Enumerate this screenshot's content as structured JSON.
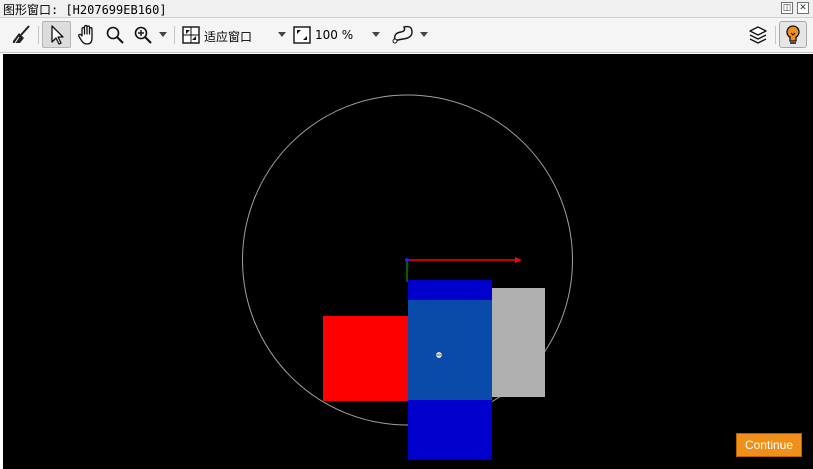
{
  "window": {
    "title": "图形窗口: [H207699EB160]",
    "restore_glyph": "◫",
    "close_glyph": "✕"
  },
  "toolbar": {
    "tools": [
      {
        "name": "clear-broom-icon",
        "active": false
      },
      {
        "name": "select-arrow-icon",
        "active": true
      },
      {
        "name": "pan-hand-icon",
        "active": false
      },
      {
        "name": "zoom-magnifier-icon",
        "active": false
      },
      {
        "name": "zoom-in-icon",
        "active": false
      }
    ],
    "fit_mode": "适应窗口",
    "zoom_level": "100 %",
    "layers_icon": "layers-icon",
    "lamp_icon": "lightbulb-icon"
  },
  "scene": {
    "background": "#000000",
    "colors": {
      "red_block": "#ff0000",
      "blue_block": "#0000cc",
      "gray_block": "#b0b0b0",
      "circle": "#a0a0a0",
      "x_axis": "#ff0000",
      "y_axis": "#00a000"
    }
  },
  "continue_label": "Continue",
  "accent": "#f0901a"
}
